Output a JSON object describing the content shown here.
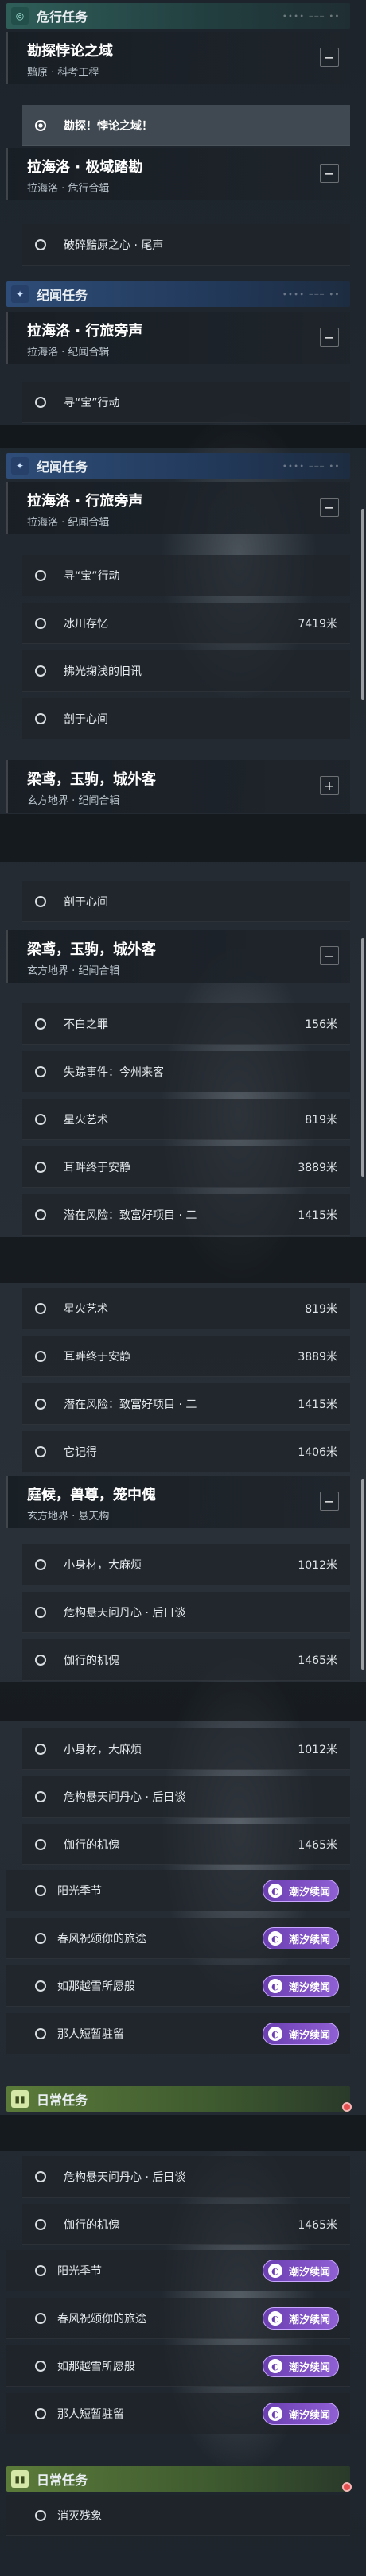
{
  "categories": {
    "danger": "危行任务",
    "legend": "纪闻任务",
    "daily": "日常任务"
  },
  "quests": {
    "q1": {
      "title": "勘探悖论之域",
      "sub": "黯原 · 科考工程"
    },
    "q2": {
      "title": "拉海洛 · 极域踏勘",
      "sub": "拉海洛 · 危行合辑"
    },
    "q3": {
      "title": "拉海洛 · 行旅旁声",
      "sub": "拉海洛 · 纪闻合辑"
    },
    "q4": {
      "title": "梁鸢，玉驹，城外客",
      "sub": "玄方地界 · 纪闻合辑"
    },
    "q5": {
      "title": "庭候，兽尊，笼中傀",
      "sub": "玄方地界 · 悬天构"
    }
  },
  "rows": {
    "explore": "勘探！悖论之域！",
    "shatter": "破碎黯原之心 · 尾声",
    "seek": "寻“宝”行动",
    "glacier": "冰川存忆",
    "old_news": "拂光掬浅的旧讯",
    "heart": "剖于心间",
    "not_white": "不白之罪",
    "missing": "失踪事件：今州来客",
    "starfire": "星火艺术",
    "earring": "耳畔终于安静",
    "risk": "潜在风险：致富好项目 · 二",
    "remember": "它记得",
    "small": "小身材，大麻烦",
    "danger_pref": "危构悬天问丹心 · 后日谈",
    "lonely": "伽行的机傀",
    "sun": "阳光季节",
    "spring": "春风祝颂你的旅途",
    "snow": "如那越雪所愿般",
    "linger": "那人短暂驻留",
    "clear": "消灭残象"
  },
  "distances": {
    "glacier": "7419米",
    "not_white": "156米",
    "starfire": "819米",
    "earring": "3889米",
    "risk": "1415米",
    "remember": "1406米",
    "small": "1012米",
    "lonely": "1465米"
  },
  "badge": {
    "label": "潮汐续闻",
    "icon": "tide-icon"
  },
  "toggle": {
    "collapse": "−",
    "expand": "+"
  },
  "icons": {
    "danger": "radar-icon",
    "legend": "compass-star-icon",
    "daily": "book-icon"
  },
  "colors": {
    "danger": "#2f5e59",
    "legend": "#2e4d78",
    "daily": "#5b7b3a",
    "badge": "#7a4bc4",
    "alert": "#e2504f"
  }
}
